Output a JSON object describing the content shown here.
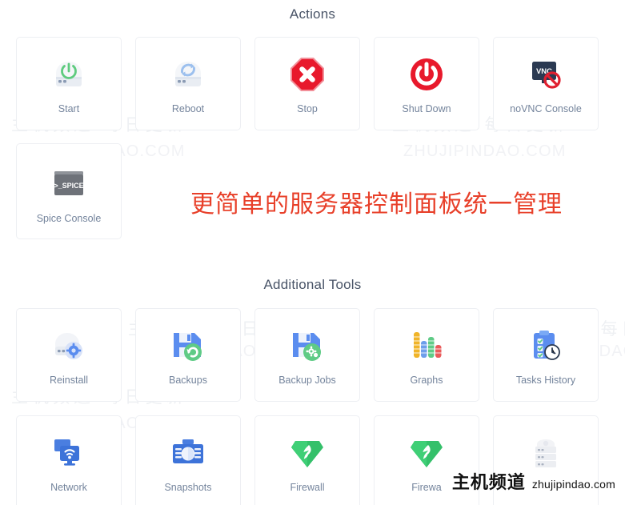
{
  "sections": [
    {
      "id": "actions",
      "title": "Actions",
      "cards": [
        {
          "label": "Start",
          "icon": "server-power-green-icon"
        },
        {
          "label": "Reboot",
          "icon": "server-refresh-blue-icon"
        },
        {
          "label": "Stop",
          "icon": "octagon-x-red-icon"
        },
        {
          "label": "Shut Down",
          "icon": "power-circle-red-icon"
        },
        {
          "label": "noVNC Console",
          "icon": "vnc-monitor-blocked-icon"
        },
        {
          "label": "Spice Console",
          "icon": "spice-terminal-icon"
        }
      ]
    },
    {
      "id": "additional-tools",
      "title": "Additional Tools",
      "cards": [
        {
          "label": "Reinstall",
          "icon": "server-gear-icon"
        },
        {
          "label": "Backups",
          "icon": "floppy-restore-icon"
        },
        {
          "label": "Backup Jobs",
          "icon": "floppy-gear-icon"
        },
        {
          "label": "Graphs",
          "icon": "bar-chart-colored-icon"
        },
        {
          "label": "Tasks History",
          "icon": "clipboard-clock-icon"
        },
        {
          "label": "Network",
          "icon": "monitors-wifi-icon"
        },
        {
          "label": "Snapshots",
          "icon": "camera-icon"
        },
        {
          "label": "Firewall",
          "icon": "shield-flame-green-icon"
        },
        {
          "label": "Firewa",
          "icon": "shield-flame-green-icon"
        },
        {
          "label": "",
          "icon": "server-stack-gray-icon"
        }
      ]
    }
  ],
  "promo": {
    "text": "更简单的服务器控制面板统一管理",
    "color": "#e8402a"
  },
  "watermark": {
    "cn_line": "主机频道 每日更新",
    "en_line": "ZHUJIPINDAO.COM"
  },
  "brand": {
    "cn": "主机频道",
    "en": "zhujipindao.com"
  },
  "colors": {
    "label": "#74849c",
    "heading": "#4a5568",
    "card_border": "#edeff3",
    "danger": "#e8192c",
    "success_green": "#3ec16a",
    "accent_blue": "#4a7ee0",
    "promo_red": "#e8402a"
  }
}
